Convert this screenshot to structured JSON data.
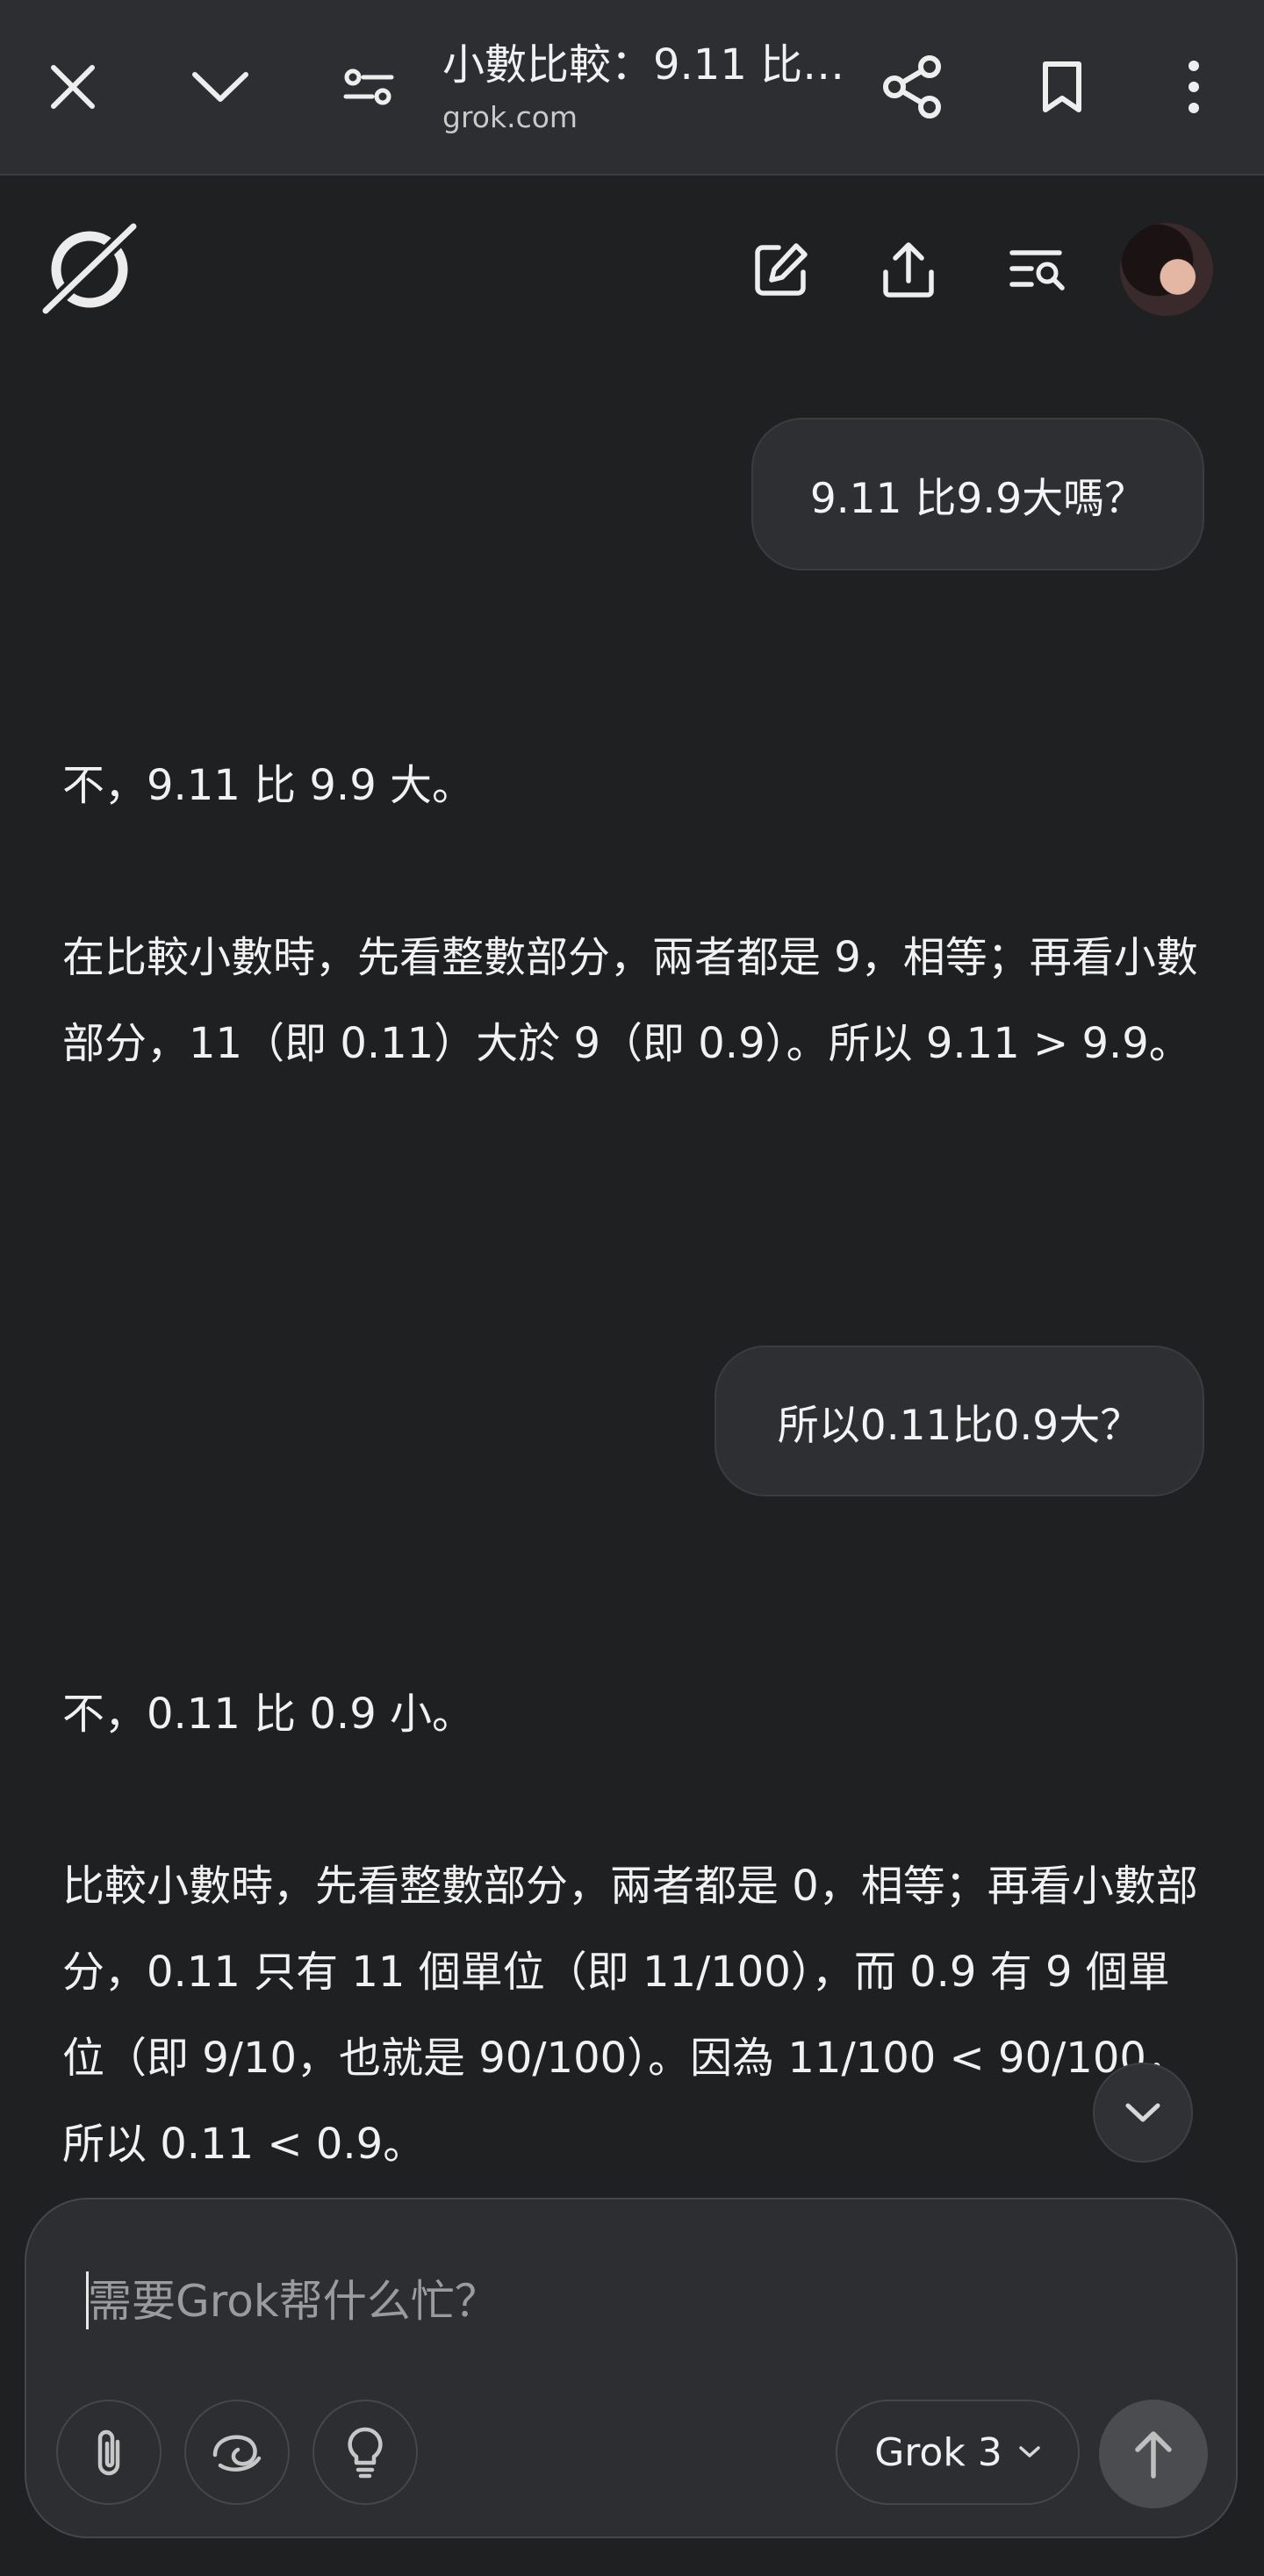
{
  "browser": {
    "title": "小數比較：9.11 比 ...",
    "domain": "grok.com"
  },
  "app": {
    "name": "Grok"
  },
  "conversation": [
    {
      "role": "user",
      "text": "9.11 比9.9大嗎？"
    },
    {
      "role": "assistant",
      "paragraphs": [
        "不，9.11 比 9.9 大。",
        "在比較小數時，先看整數部分，兩者都是 9，相等；再看小數部分，11（即 0.11）大於 9（即 0.9）。所以 9.11 > 9.9。"
      ]
    },
    {
      "role": "user",
      "text": "所以0.11比0.9大？"
    },
    {
      "role": "assistant",
      "paragraphs": [
        "不，0.11 比 0.9 小。",
        "比較小數時，先看整數部分，兩者都是 0，相等；再看小數部分，0.11 只有 11 個單位（即 11/100），而 0.9 有 9 個單位（即 9/10，也就是 90/100）。因為 11/100 < 90/100，所以 0.11 < 0.9。"
      ]
    }
  ],
  "composer": {
    "placeholder": "需要Grok帮什么忙？",
    "model_label": "Grok 3"
  },
  "icons": {
    "close": "close-icon",
    "dropdown": "chevron-down-icon",
    "site_settings": "tune-icon",
    "share": "share-icon",
    "bookmark": "bookmark-icon",
    "menu": "more-vert-icon",
    "logo": "grok-logo-icon",
    "new_chat": "edit-icon",
    "export": "upload-icon",
    "history": "search-history-icon",
    "attach": "paperclip-icon",
    "deep_search": "swirl-icon",
    "think": "lightbulb-icon",
    "send": "arrow-up-icon",
    "scroll": "chevron-down-icon"
  }
}
